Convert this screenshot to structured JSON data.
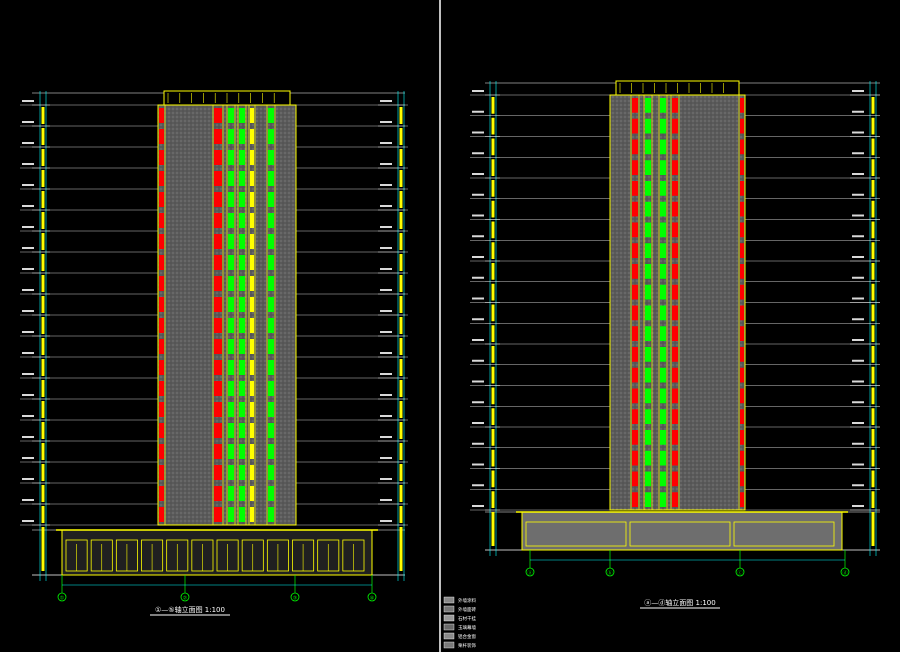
{
  "colors": {
    "background": "#000000",
    "frame": "#ffffff",
    "dimension": "#00ffff",
    "outline": "#ffff00",
    "window_red": "#ff0000",
    "window_green": "#00ff00",
    "facade": "#5a5a5a",
    "podium": "#6e6e6e",
    "axis": "#00ff00",
    "title": "#ffffff"
  },
  "drawings": [
    {
      "id": "left-elevation",
      "title": "①—⑤轴立面图 1:100",
      "axis_labels": [
        "①",
        "②",
        "③",
        "④"
      ],
      "floors": 20
    },
    {
      "id": "right-elevation",
      "title": "ⓐ—ⓓ轴立面图 1:100",
      "axis_labels": [
        "ⓐ",
        "ⓑ",
        "ⓒ",
        "ⓓ"
      ],
      "floors": 20
    }
  ],
  "legend": {
    "items": [
      "外墙涂料",
      "外墙面砖",
      "石材干挂",
      "玉璃幕墙",
      "铝合金窗",
      "栗杆装饰"
    ],
    "swatch_colors": [
      "#888888",
      "#777777",
      "#999999",
      "#6a6a6a",
      "#8a8a8a",
      "#7a7a7a"
    ]
  }
}
